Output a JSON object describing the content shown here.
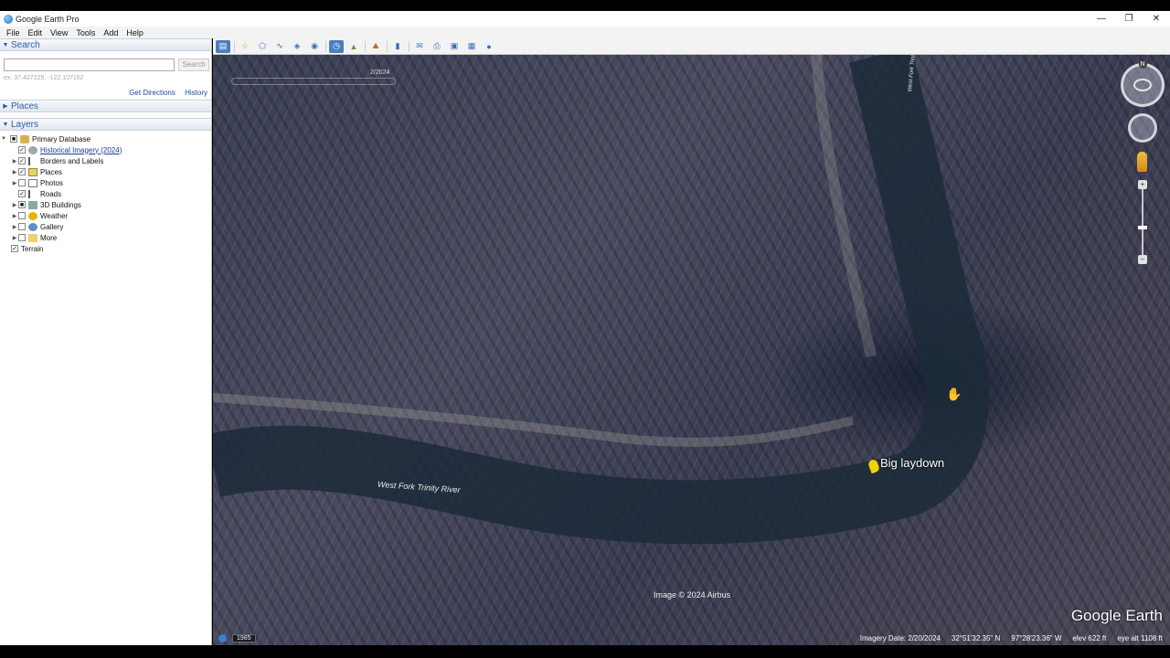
{
  "window": {
    "title": "Google Earth Pro",
    "controls": {
      "minimize": "—",
      "restore": "❐",
      "close": "✕"
    }
  },
  "menu": [
    "File",
    "Edit",
    "View",
    "Tools",
    "Add",
    "Help"
  ],
  "sidebar": {
    "search": {
      "header": "Search",
      "placeholder": "",
      "button": "Search",
      "hint": "ex: 37.407229, -122.107162",
      "get_directions": "Get Directions",
      "history": "History"
    },
    "places_header": "Places",
    "layers_header": "Layers",
    "layers": [
      {
        "label": "Primary Database",
        "checked": "partial",
        "indent": 0
      },
      {
        "label": "Historical Imagery (2024)",
        "checked": true,
        "indent": 1,
        "link": true
      },
      {
        "label": "Borders and Labels",
        "checked": true,
        "indent": 1
      },
      {
        "label": "Places",
        "checked": true,
        "indent": 1
      },
      {
        "label": "Photos",
        "checked": false,
        "indent": 1
      },
      {
        "label": "Roads",
        "checked": true,
        "indent": 1
      },
      {
        "label": "3D Buildings",
        "checked": "partial",
        "indent": 1
      },
      {
        "label": "Weather",
        "checked": false,
        "indent": 1
      },
      {
        "label": "Gallery",
        "checked": false,
        "indent": 1
      },
      {
        "label": "More",
        "checked": false,
        "indent": 1
      },
      {
        "label": "Terrain",
        "checked": true,
        "indent": 0
      }
    ]
  },
  "map": {
    "time_slider_label": "2/2024",
    "river_label_main": "West Fork Trinity River",
    "river_label_side": "West Fork Trinity River",
    "placemark": "Big laydown",
    "credit": "Image © 2024 Airbus",
    "logo": "Google Earth",
    "compass_north": "N"
  },
  "status": {
    "year": "1985",
    "imagery_date": "Imagery Date: 2/20/2024",
    "lat": "32°51'32.35\" N",
    "lon": "97°28'23.36\" W",
    "elev": "elev   622 ft",
    "eye_alt": "eye alt   1108 ft"
  }
}
